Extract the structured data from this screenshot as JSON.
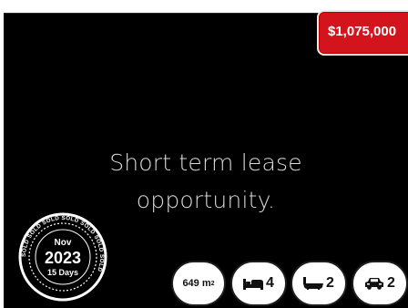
{
  "listing": {
    "price": "$1,075,000",
    "headline_line1": "Short term lease",
    "headline_line2": "opportunity."
  },
  "sold_stamp": {
    "ring_word": "SOLD",
    "month": "Nov",
    "year": "2023",
    "days": "15 Days"
  },
  "features": {
    "area_value": "649 m",
    "area_unit_sup": "2",
    "bedrooms": "4",
    "bathrooms": "2",
    "car_spaces": "2"
  },
  "icons": {
    "bed": "bed-icon",
    "bath": "bath-icon",
    "car": "car-icon"
  },
  "colors": {
    "price_tag": "#d4141c",
    "media_bg": "#000000",
    "feature_pill_bg": "#ffffff",
    "feature_pill_border": "#1e1e1e"
  }
}
